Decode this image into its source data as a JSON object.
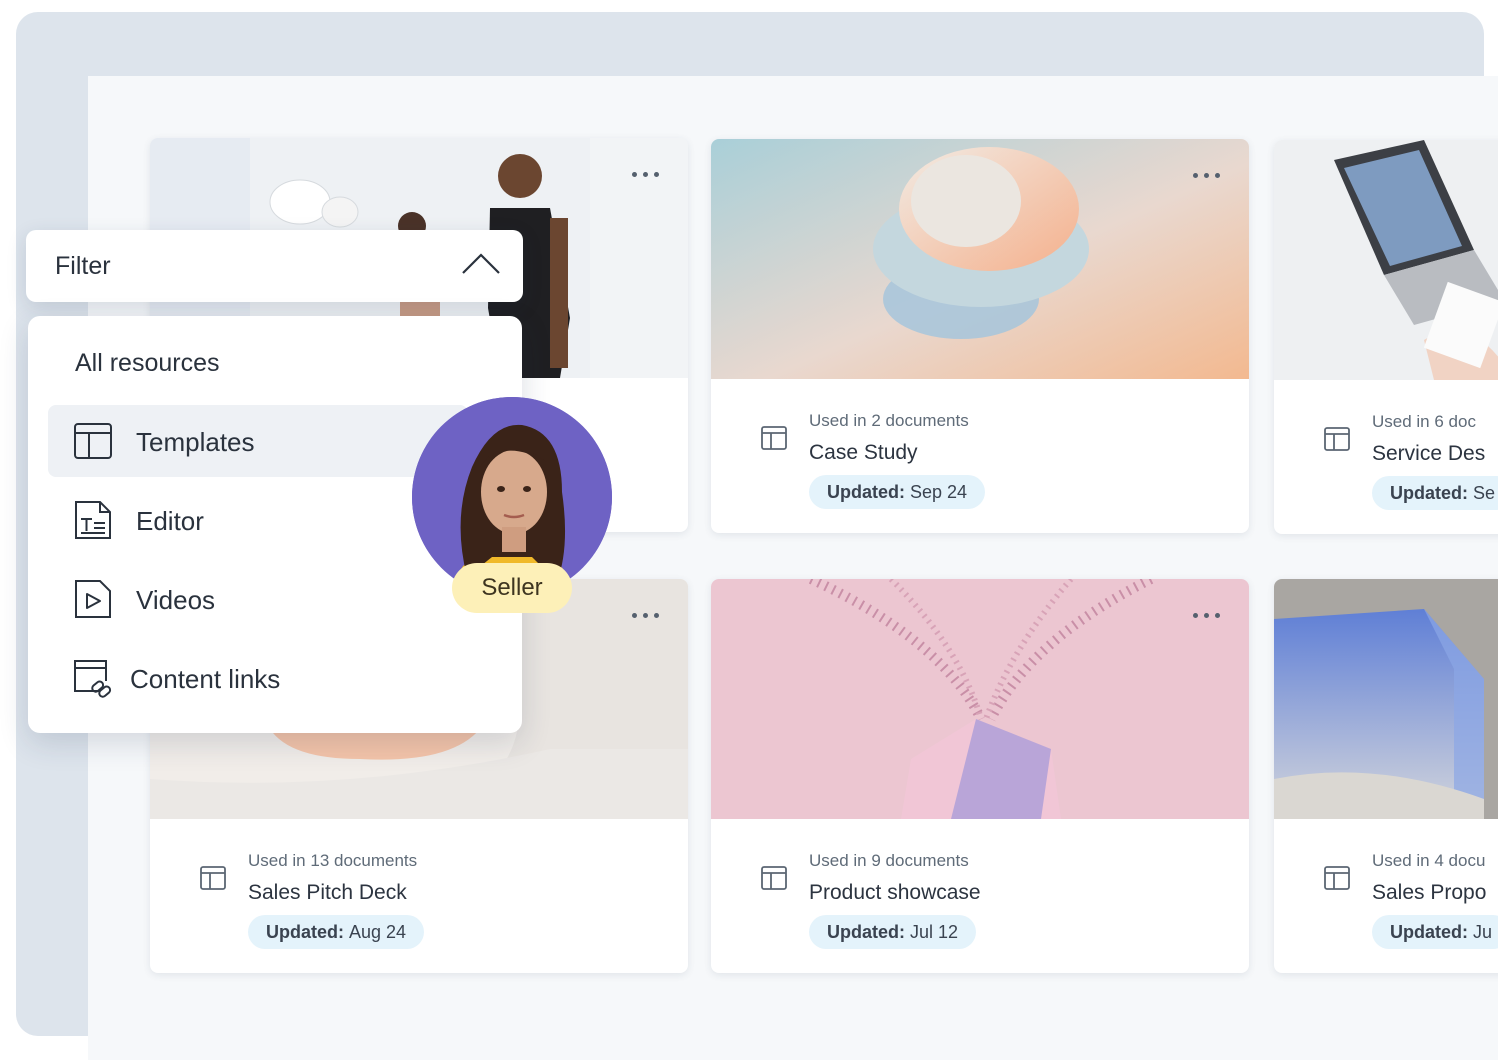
{
  "filter": {
    "label": "Filter",
    "toggle_icon": "chevron-up-icon",
    "heading": "All resources",
    "items": [
      {
        "label": "Templates",
        "icon": "template-layout-icon",
        "active": true
      },
      {
        "label": "Editor",
        "icon": "text-editor-icon",
        "active": false
      },
      {
        "label": "Videos",
        "icon": "video-play-icon",
        "active": false
      },
      {
        "label": "Content links",
        "icon": "content-link-icon",
        "active": false
      }
    ]
  },
  "seller": {
    "label": "Seller"
  },
  "cards": [
    {
      "meta": "",
      "title": "",
      "badge_label": "",
      "badge_value": "",
      "image": "people-office-photo"
    },
    {
      "meta": "Used in 2 documents",
      "title": "Case Study",
      "badge_label": "Updated:",
      "badge_value": "Sep 24",
      "image": "pastel-3d-shapes"
    },
    {
      "meta": "Used in 6 doc",
      "title": "Service Des",
      "badge_label": "Updated:",
      "badge_value": "Se",
      "image": "laptop-desk-photo"
    },
    {
      "meta": "Used in 13 documents",
      "title": "Sales Pitch Deck",
      "badge_label": "Updated:",
      "badge_value": "Aug 24",
      "image": "abstract-cream-shape"
    },
    {
      "meta": "Used in 9 documents",
      "title": "Product showcase",
      "badge_label": "Updated:",
      "badge_value": "Jul 12",
      "image": "pink-crystal-glitter"
    },
    {
      "meta": "Used in 4 docu",
      "title": "Sales Propo",
      "badge_label": "Updated:",
      "badge_value": "Ju",
      "image": "blue-glass-box"
    }
  ],
  "colors": {
    "badge_bg": "#e4f3fb",
    "seller_bg": "#fdf0b8",
    "avatar_bg": "#6e62c4",
    "frame_bg": "#dde4ec"
  }
}
